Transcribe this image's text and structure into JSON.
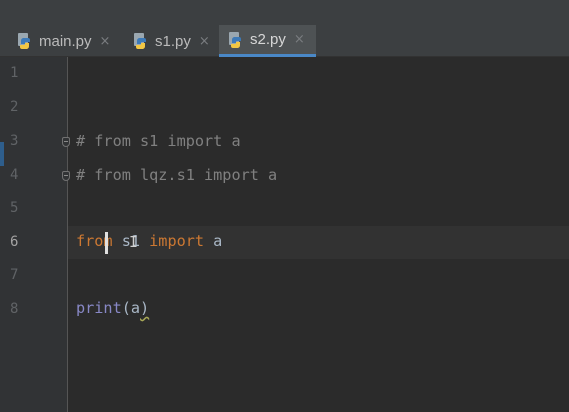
{
  "tabs": [
    {
      "label": "main.py",
      "icon": "python-file-icon",
      "active": false
    },
    {
      "label": "s1.py",
      "icon": "python-file-icon",
      "active": false
    },
    {
      "label": "s2.py",
      "icon": "python-file-icon",
      "active": true
    }
  ],
  "close_glyph": "×",
  "editor": {
    "line_numbers": [
      "1",
      "2",
      "3",
      "4",
      "5",
      "6",
      "7",
      "8"
    ],
    "current_line": 6,
    "lines": {
      "l3": "# from s1 import a",
      "l4": "# from lqz.s1 import a",
      "l6": {
        "kw_from": "from",
        "module": " s1 ",
        "kw_import": "import",
        "name": " a"
      },
      "l8": {
        "func": "print",
        "open": "(",
        "arg": "a",
        "close": ")"
      }
    }
  },
  "colors": {
    "editor_bg": "#2b2b2b",
    "gutter_bg": "#313335",
    "keyword": "#cc7832",
    "comment": "#808080",
    "builtin": "#8888c6",
    "text": "#a9b7c6",
    "active_tab_underline": "#4a88c7"
  }
}
